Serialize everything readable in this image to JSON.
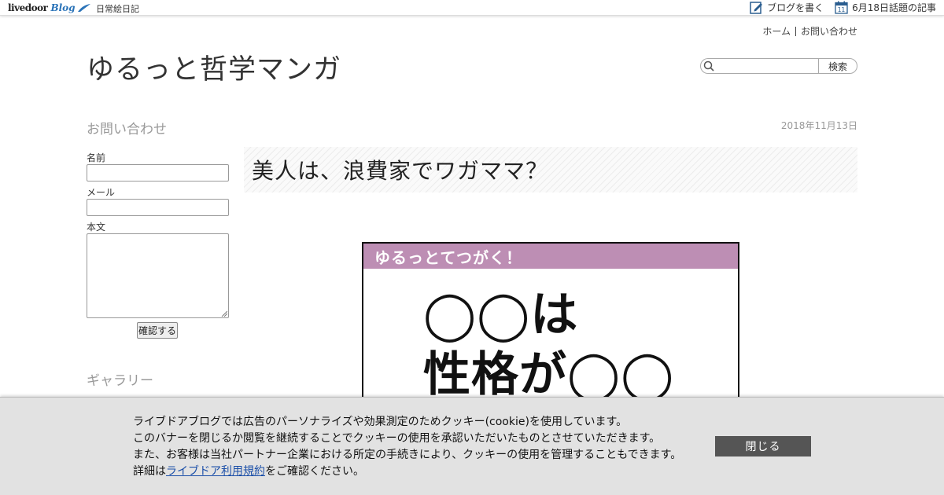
{
  "topbar": {
    "logo_text": "livedoor",
    "logo_blog": "Blog",
    "blog_name": "日常絵日記",
    "write_label": "ブログを書く",
    "calendar_day": "11",
    "topic_label": "6月18日話題の記事"
  },
  "header": {
    "nav": [
      "ホーム",
      "お問い合わせ"
    ],
    "site_title": "ゆるっと哲学マンガ",
    "search": {
      "placeholder": "",
      "button_label": "検索"
    }
  },
  "sidebar": {
    "contact_heading": "お問い合わせ",
    "name_label": "名前",
    "mail_label": "メール",
    "body_label": "本文",
    "confirm_label": "確認する",
    "gallery_heading": "ギャラリー"
  },
  "article": {
    "date": "2018年11月13日",
    "title": "美人は、浪費家でワガママ？",
    "image": {
      "band_text": "ゆるっとてつがく！",
      "line1": "◯◯は",
      "line2": "性格が◯◯"
    }
  },
  "cookie": {
    "lines": [
      "ライブドアブログでは広告のパーソナライズや効果測定のためクッキー(cookie)を使用しています。",
      "このバナーを閉じるか閲覧を継続することでクッキーの使用を承認いただいたものとさせていただきます。",
      "また、お客様は当社パートナー企業における所定の手続きにより、クッキーの使用を管理することもできます。"
    ],
    "detail_prefix": "詳細は",
    "detail_link": "ライブドア利用規約",
    "detail_suffix": "をご確認ください。",
    "close_label": "閉じる"
  },
  "colors": {
    "accent_blue": "#2a73b8",
    "manga_band": "#bd8eb4",
    "close_button": "#555555",
    "link": "#1a4ea8"
  }
}
